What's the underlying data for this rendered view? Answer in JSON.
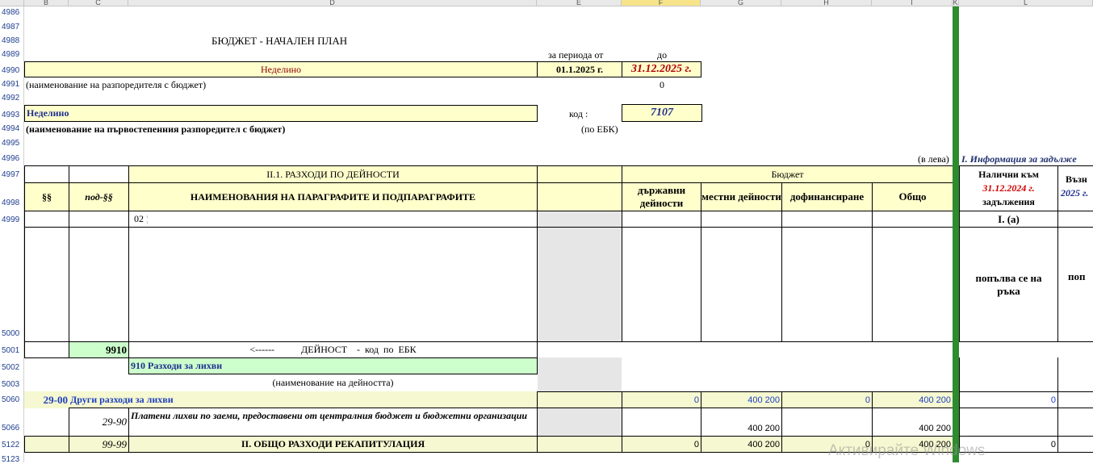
{
  "columns": [
    "B",
    "C",
    "D",
    "E",
    "F",
    "G",
    "H",
    "I",
    "K",
    "L"
  ],
  "rows": [
    "4986",
    "4987",
    "4988",
    "4989",
    "4990",
    "4991",
    "4992",
    "4993",
    "4994",
    "4995",
    "4996",
    "4997",
    "4998",
    "4999",
    "5000",
    "5001",
    "5002",
    "5003",
    "5060",
    "5066",
    "5122",
    "5123"
  ],
  "top": {
    "title": "БЮДЖЕТ - НАЧАЛЕН ПЛАН",
    "period_from_label": "за периода от",
    "period_to_label": "до",
    "municipality": "Неделино",
    "date_from": "01.1.2025 г.",
    "date_to": "31.12.2025 г.",
    "spender_note": "(наименование на разпоредителя с бюджет)",
    "zero_value": "0",
    "primary_name": "Неделино",
    "primary_note": "(наименование на първостепенния разпоредител с бюджет)",
    "code_label": "код :",
    "code_value": "7107",
    "ebk_note": "(по ЕБК)",
    "currency_note": "(в лева)",
    "info_header": "I. Информация за задълже"
  },
  "table": {
    "section_title": "II.1. РАЗХОДИ ПО ДЕЙНОСТИ",
    "budget_header": "Бюджет",
    "col_par": "§§",
    "col_subpar": "под-§§",
    "col_names": "НАИМЕНОВАНИЯ НА ПАРАГРАФИТЕ И ПОДПАРАГРАФИТЕ",
    "col_state": "държавни дейности",
    "col_local": "местни дейности",
    "col_cofin": "дофинансиране",
    "col_total": "Общо",
    "col_available": "Налични към",
    "col_available_date": "31.12.2024 г.",
    "col_liabilities": "задължения",
    "col_next_a": "Възн",
    "col_next_b": "2025 г.",
    "row4999_code": "02",
    "row4999_info": "I. (a)",
    "manual_fill": "попълва се на ръка",
    "manual_fill_cut": "поп",
    "activity_code": "9910",
    "activity_label": "<------           ДЕЙНОСТ    -  код  по  ЕБК",
    "activity_name": "910 Разходи за лихви",
    "activity_name_note": "(наименование на дейността)",
    "r5060_par": "29-00",
    "r5060_name": "Други разходи за лихви",
    "r5060_state": "0",
    "r5060_local": "400 200",
    "r5060_cofin": "0",
    "r5060_total": "400 200",
    "r5060_info": "0",
    "r5066_sub": "29-90",
    "r5066_name": "Платени лихви по заеми, предоставени от централния бюджет и бюджетни организации",
    "r5066_local": "400 200",
    "r5066_total": "400 200",
    "r5122_sub": "99-99",
    "r5122_name": "II. ОБЩО РАЗХОДИ РЕКАПИТУЛАЦИЯ",
    "r5122_state": "0",
    "r5122_local": "400 200",
    "r5122_cofin": "0",
    "r5122_total": "400 200",
    "r5122_info": "0"
  },
  "watermark": "Активирайте Windows",
  "colors": {
    "yellow": "#ffffcc",
    "green": "#ccffcc",
    "frozen_bar": "#2e8b2e",
    "selected_col": "#f7e48a"
  }
}
